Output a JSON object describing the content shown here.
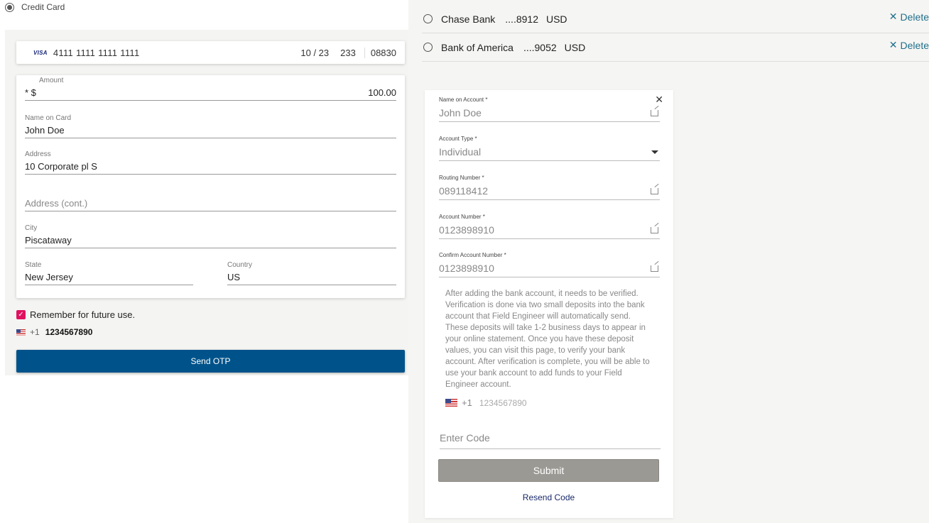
{
  "payment_method": {
    "label": "Credit Card"
  },
  "card": {
    "brand": "VISA",
    "number": "4111 1111 1111 1111",
    "expiry": "10 / 23",
    "cvc": "233",
    "zip": "08830"
  },
  "form": {
    "amount": {
      "label": "Amount",
      "prefix": "* $",
      "value": "100.00"
    },
    "name_on_card": {
      "label": "Name on Card",
      "value": "John Doe"
    },
    "address": {
      "label": "Address",
      "value": "10 Corporate pl S"
    },
    "address_cont": {
      "placeholder": "Address (cont.)"
    },
    "city": {
      "label": "City",
      "value": "Piscataway"
    },
    "state": {
      "label": "State",
      "value": "New Jersey"
    },
    "country": {
      "label": "Country",
      "value": "US"
    }
  },
  "remember": {
    "label": "Remember for future use.",
    "checked": true
  },
  "phone": {
    "country_code": "+1",
    "number": "1234567890"
  },
  "send_otp": {
    "label": "Send OTP"
  },
  "banks": [
    {
      "name": "Chase Bank",
      "account": "....8912",
      "currency": "USD",
      "delete_label": "Delete"
    },
    {
      "name": "Bank of America",
      "account": "....9052",
      "currency": "USD",
      "delete_label": "Delete"
    }
  ],
  "bank_form": {
    "close_icon": "close-icon",
    "name_on_account": {
      "label": "Name on Account *",
      "value": "John Doe"
    },
    "account_type": {
      "label": "Account Type *",
      "value": "Individual"
    },
    "routing_number": {
      "label": "Routing Number *",
      "value": "089118412"
    },
    "account_number": {
      "label": "Account Number *",
      "value": "0123898910"
    },
    "confirm_account_number": {
      "label": "Confirm Account Number *",
      "value": "0123898910"
    },
    "info": "After adding the bank account, it needs to be verified. Verification is done via two small deposits into the bank account that Field Engineer will automatically send. These deposits will take 1-2 business days to appear in your online statement. Once you have these deposit values, you can visit this page, to verify your bank account. After verification is complete, you will be able to use your bank account to add funds to your Field Engineer account.",
    "phone": {
      "country_code": "+1",
      "placeholder": "1234567890"
    },
    "code": {
      "placeholder": "Enter Code"
    },
    "submit_label": "Submit",
    "resend_label": "Resend Code"
  },
  "colors": {
    "primary": "#00538a",
    "accent": "#e0115f",
    "link": "#1f6f8b",
    "disabled": "#9b9993"
  }
}
